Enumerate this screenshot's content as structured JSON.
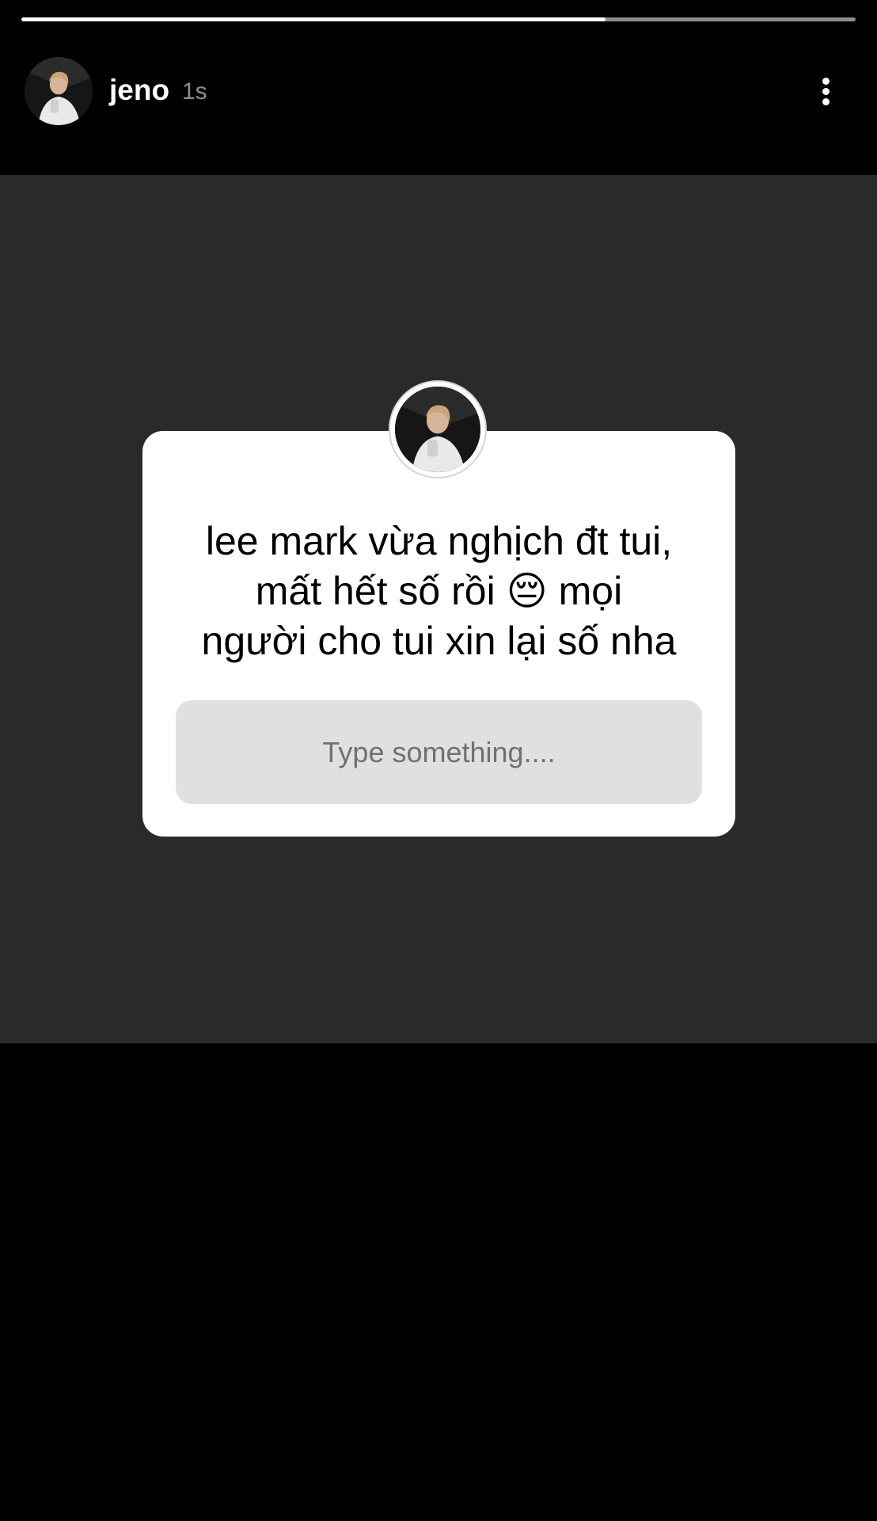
{
  "story": {
    "progress_fraction": 0.7
  },
  "header": {
    "username": "jeno",
    "timestamp": "1s"
  },
  "question_sticker": {
    "text": "lee mark vừa nghịch đt tui,\nmất hết số rồi 😔 mọi\nngười cho tui xin lại số nha",
    "answer_placeholder": "Type something...."
  },
  "icons": {
    "more": "more-options-icon",
    "emoji": "pensive-face-emoji"
  },
  "colors": {
    "background": "#000000",
    "story_area": "#2a2a2a",
    "card": "#ffffff",
    "answer_field": "#e0e0e0",
    "timestamp": "#8e8e8e"
  }
}
